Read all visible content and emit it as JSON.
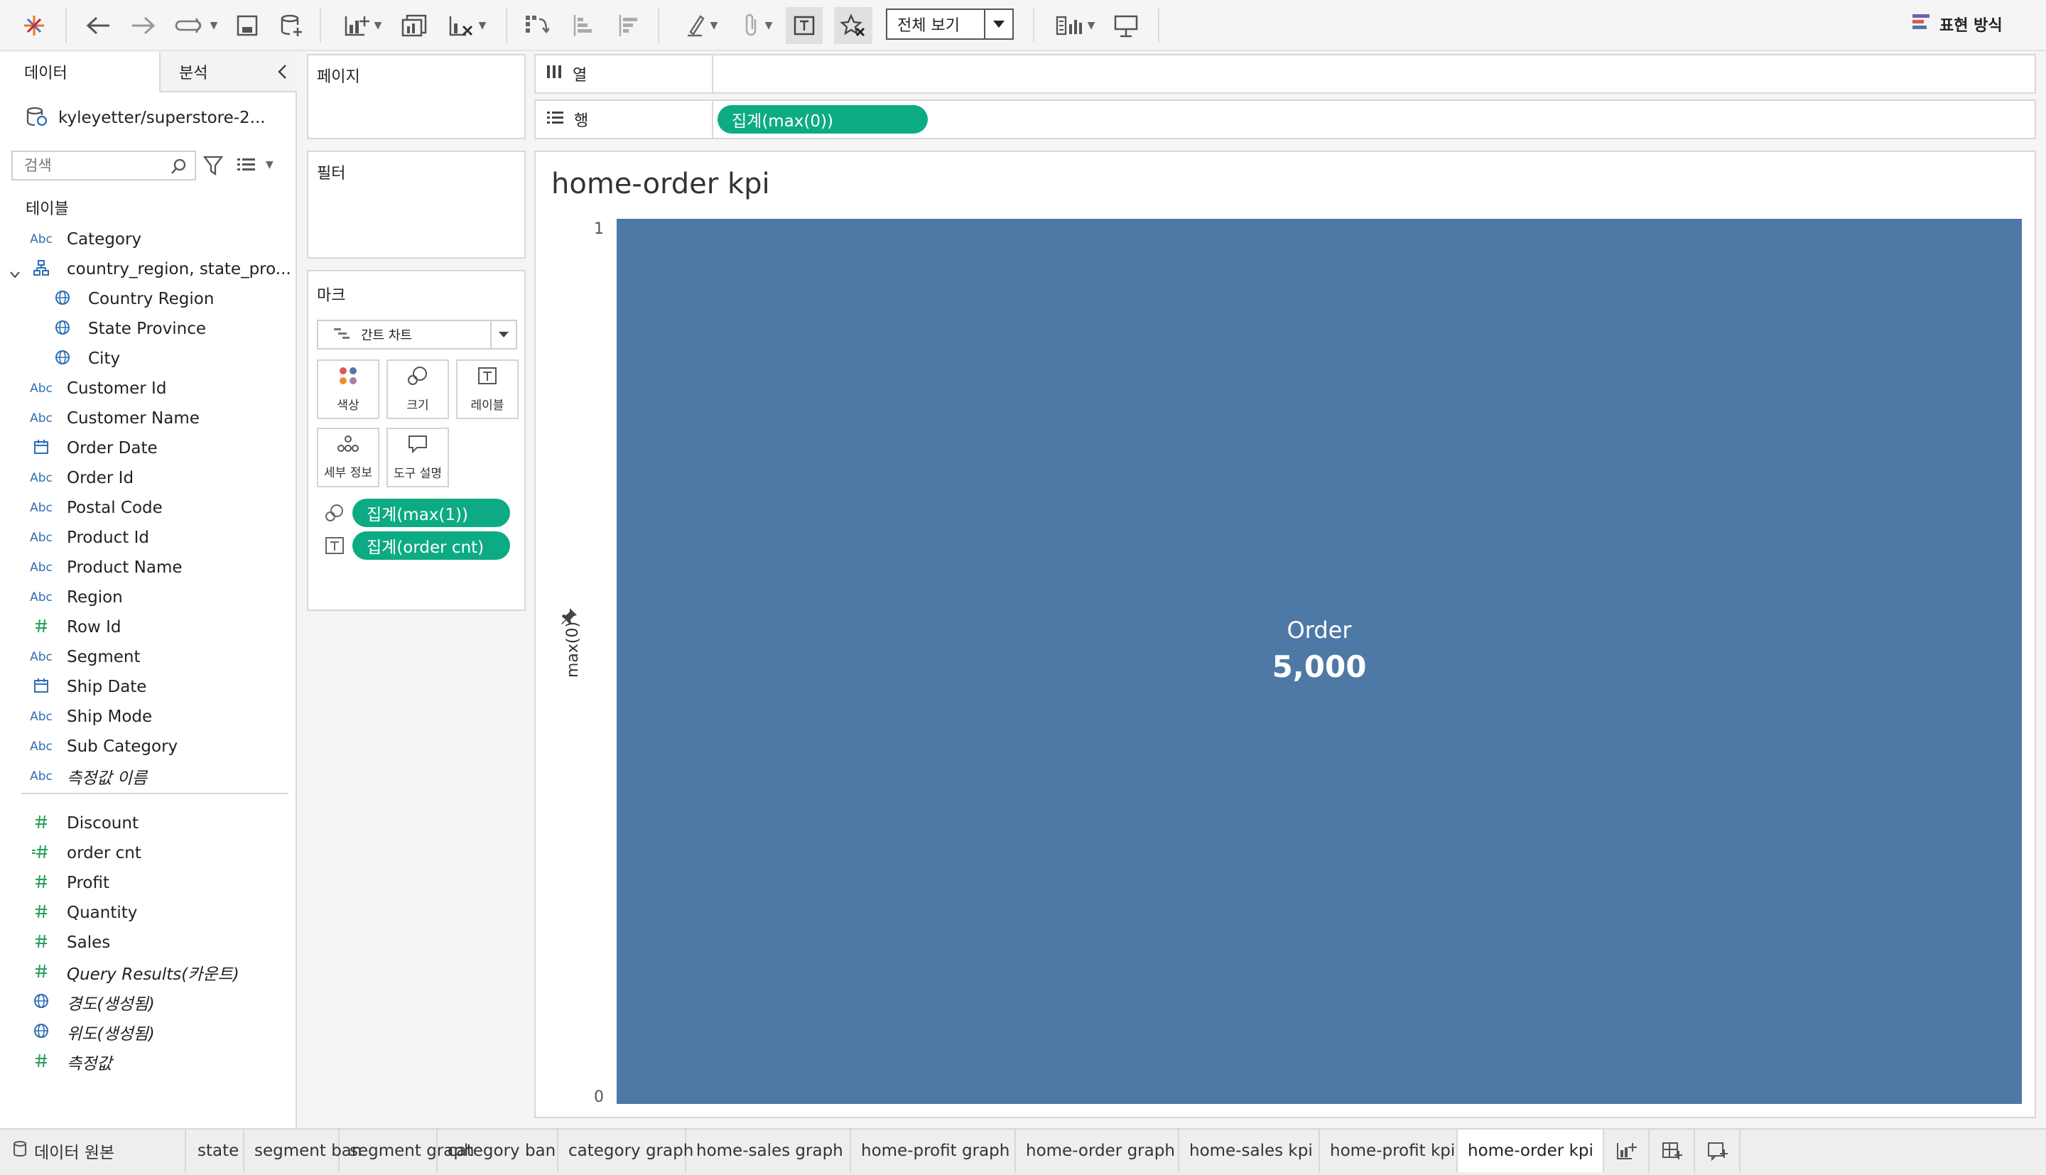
{
  "toolbar": {
    "view_select_value": "전체 보기",
    "show_me_label": "표현 방식"
  },
  "left_panel": {
    "tab_data": "데이터",
    "tab_analysis": "분석",
    "datasource": "kyleyetter/superstore-2...",
    "search_placeholder": "검색",
    "tables_header": "테이블",
    "fields": [
      {
        "type": "Abc",
        "label": "Category"
      },
      {
        "type": "hier",
        "label": "country_region, state_pro..."
      },
      {
        "type": "geo",
        "label": "Country Region",
        "sub": true
      },
      {
        "type": "geo",
        "label": "State Province",
        "sub": true
      },
      {
        "type": "geo",
        "label": "City",
        "sub": true
      },
      {
        "type": "Abc",
        "label": "Customer Id"
      },
      {
        "type": "Abc",
        "label": "Customer Name"
      },
      {
        "type": "date",
        "label": "Order Date"
      },
      {
        "type": "Abc",
        "label": "Order Id"
      },
      {
        "type": "Abc",
        "label": "Postal Code"
      },
      {
        "type": "Abc",
        "label": "Product Id"
      },
      {
        "type": "Abc",
        "label": "Product Name"
      },
      {
        "type": "Abc",
        "label": "Region"
      },
      {
        "type": "num",
        "label": "Row Id"
      },
      {
        "type": "Abc",
        "label": "Segment"
      },
      {
        "type": "date",
        "label": "Ship Date"
      },
      {
        "type": "Abc",
        "label": "Ship Mode"
      },
      {
        "type": "Abc",
        "label": "Sub Category"
      },
      {
        "type": "Abc",
        "label": "측정값 이름",
        "italic": true
      }
    ],
    "measures": [
      {
        "type": "num",
        "label": "Discount"
      },
      {
        "type": "calc",
        "label": "order cnt"
      },
      {
        "type": "num",
        "label": "Profit"
      },
      {
        "type": "num",
        "label": "Quantity"
      },
      {
        "type": "num",
        "label": "Sales"
      },
      {
        "type": "num",
        "label": "Query Results(카운트)",
        "italic": true
      },
      {
        "type": "geo",
        "label": "경도(생성됨)",
        "italic": true
      },
      {
        "type": "geo",
        "label": "위도(생성됨)",
        "italic": true
      },
      {
        "type": "num",
        "label": "측정값",
        "italic": true
      }
    ]
  },
  "cards": {
    "pages": "페이지",
    "filters": "필터",
    "marks": "마크",
    "mark_type": "간트 차트",
    "buttons": {
      "color": "색상",
      "size": "크기",
      "label": "레이블",
      "detail": "세부 정보",
      "tooltip": "도구 설명"
    },
    "mark_pills": [
      "집계(max(1))",
      "집계(order cnt)"
    ]
  },
  "shelves": {
    "columns_label": "열",
    "rows_label": "행",
    "rows_pill": "집계(max(0))"
  },
  "view": {
    "title": "home-order kpi",
    "kpi_label": "Order",
    "kpi_value": "5,000",
    "y_axis_label": "max(0)",
    "y_tick_top": "1",
    "y_tick_bottom": "0"
  },
  "bottom_tabs": {
    "datasource_tab": "데이터 원본",
    "sheets": [
      "state",
      "segment ban",
      "segment graph",
      "category ban",
      "category graph",
      "home-sales graph",
      "home-profit graph",
      "home-order graph",
      "home-sales kpi",
      "home-profit kpi",
      "home-order kpi"
    ],
    "active": "home-order kpi"
  },
  "colors": {
    "bar": "#4e79a7",
    "pill": "#0dab83",
    "dimension_icon": "#2e6fb5",
    "measure_icon": "#27a05a"
  }
}
